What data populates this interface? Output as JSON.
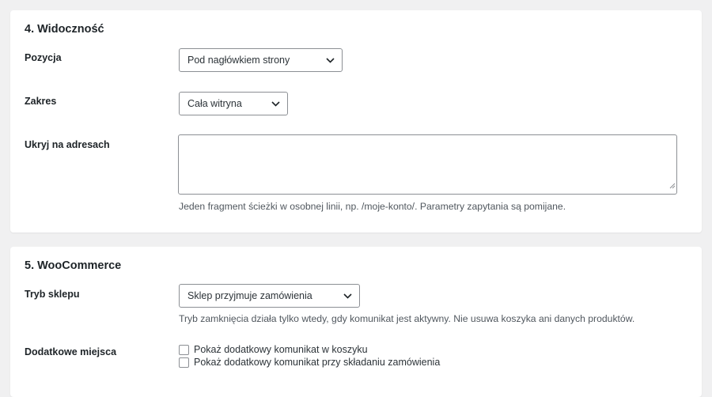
{
  "visibility": {
    "title": "4. Widoczność",
    "position": {
      "label": "Pozycja",
      "value": "Pod nagłówkiem strony"
    },
    "scope": {
      "label": "Zakres",
      "value": "Cała witryna"
    },
    "hide_on": {
      "label": "Ukryj na adresach",
      "value": "",
      "help": "Jeden fragment ścieżki w osobnej linii, np. /moje-konto/. Parametry zapytania są pomijane."
    }
  },
  "woocommerce": {
    "title": "5. WooCommerce",
    "shop_mode": {
      "label": "Tryb sklepu",
      "value": "Sklep przyjmuje zamówienia",
      "help": "Tryb zamknięcia działa tylko wtedy, gdy komunikat jest aktywny. Nie usuwa koszyka ani danych produktów."
    },
    "extra_places": {
      "label": "Dodatkowe miejsca",
      "options": [
        {
          "label": "Pokaż dodatkowy komunikat w koszyku",
          "checked": false
        },
        {
          "label": "Pokaż dodatkowy komunikat przy składaniu zamówienia",
          "checked": false
        }
      ]
    }
  },
  "icons": {
    "select_arrow": "chevron-down-icon",
    "resize": "resize-grip-icon"
  }
}
